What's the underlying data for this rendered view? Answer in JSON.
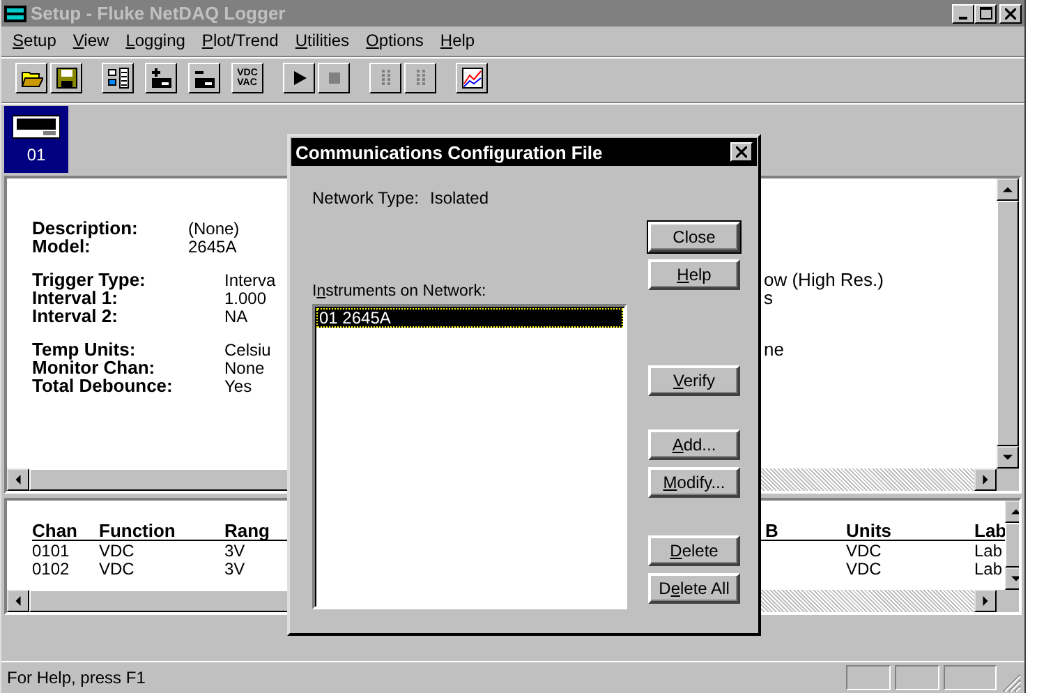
{
  "window": {
    "title": "Setup - Fluke NetDAQ Logger"
  },
  "menu": [
    {
      "key": "S",
      "post": "etup"
    },
    {
      "key": "V",
      "post": "iew"
    },
    {
      "key": "L",
      "post": "ogging"
    },
    {
      "key": "P",
      "post": "lot/Trend"
    },
    {
      "key": "U",
      "post": "tilities"
    },
    {
      "key": "O",
      "post": "ptions"
    },
    {
      "key": "H",
      "post": "elp"
    }
  ],
  "toolbar": [
    [
      {
        "kind": "open",
        "disabled": false
      },
      {
        "kind": "save",
        "disabled": false
      }
    ],
    [
      {
        "kind": "config",
        "disabled": false
      },
      {
        "kind": "add-channel",
        "disabled": false
      },
      {
        "kind": "remove-channel",
        "disabled": false
      },
      {
        "kind": "function",
        "disabled": false,
        "lines": [
          "VDC",
          "VAC"
        ]
      }
    ],
    [
      {
        "kind": "play",
        "disabled": false
      },
      {
        "kind": "stop",
        "disabled": true
      }
    ],
    [
      {
        "kind": "bars",
        "disabled": true
      },
      {
        "kind": "bars",
        "disabled": true
      }
    ],
    [
      {
        "kind": "chart",
        "disabled": false
      }
    ]
  ],
  "instruments": [
    {
      "label": "01",
      "selected": true
    }
  ],
  "details": [
    [
      {
        "label": "Description:",
        "value": "(None)"
      },
      {
        "label": "Model:",
        "value": "2645A"
      }
    ],
    [
      {
        "label": "Trigger Type:",
        "value": "Interva",
        "value_right": "ow (High Res.)"
      },
      {
        "label": "Interval 1:",
        "value": "1.000",
        "value_right": "s"
      },
      {
        "label": "Interval 2:",
        "value": "NA"
      }
    ],
    [
      {
        "label": "Temp Units:",
        "value": "Celsiu",
        "value_right": "ne"
      },
      {
        "label": "Monitor Chan:",
        "value": "None"
      },
      {
        "label": "Total Debounce:",
        "value": "Yes"
      }
    ]
  ],
  "channels": {
    "columns": [
      "Chan",
      "Function",
      "Rang",
      null,
      "B",
      "Units",
      "Lab"
    ],
    "rows": [
      [
        "0101",
        "VDC",
        "3V",
        null,
        null,
        "VDC",
        "Lab"
      ],
      [
        "0102",
        "VDC",
        "3V",
        null,
        null,
        "VDC",
        "Lab"
      ]
    ]
  },
  "dialog": {
    "title": "Communications Configuration File",
    "network_label": "Network Type:",
    "network_value": "Isolated",
    "list_label": {
      "pre": "I",
      "key": "n",
      "post": "struments on Network:"
    },
    "list_items": [
      {
        "text": "01  2645A",
        "selected": true
      }
    ],
    "button_groups": [
      [
        {
          "label": "Close",
          "default": true
        },
        {
          "key": "H",
          "post": "elp",
          "default": false
        }
      ],
      [
        {
          "key": "V",
          "post": "erify",
          "default": false
        }
      ],
      [
        {
          "key": "A",
          "post": "dd...",
          "default": false
        },
        {
          "key": "M",
          "post": "odify...",
          "default": false
        }
      ],
      [
        {
          "key": "D",
          "post": "elete",
          "default": false
        },
        {
          "pre": "D",
          "key": "e",
          "post": "lete All",
          "default": false
        }
      ]
    ]
  },
  "status_bar": {
    "text": "For Help, press F1"
  }
}
